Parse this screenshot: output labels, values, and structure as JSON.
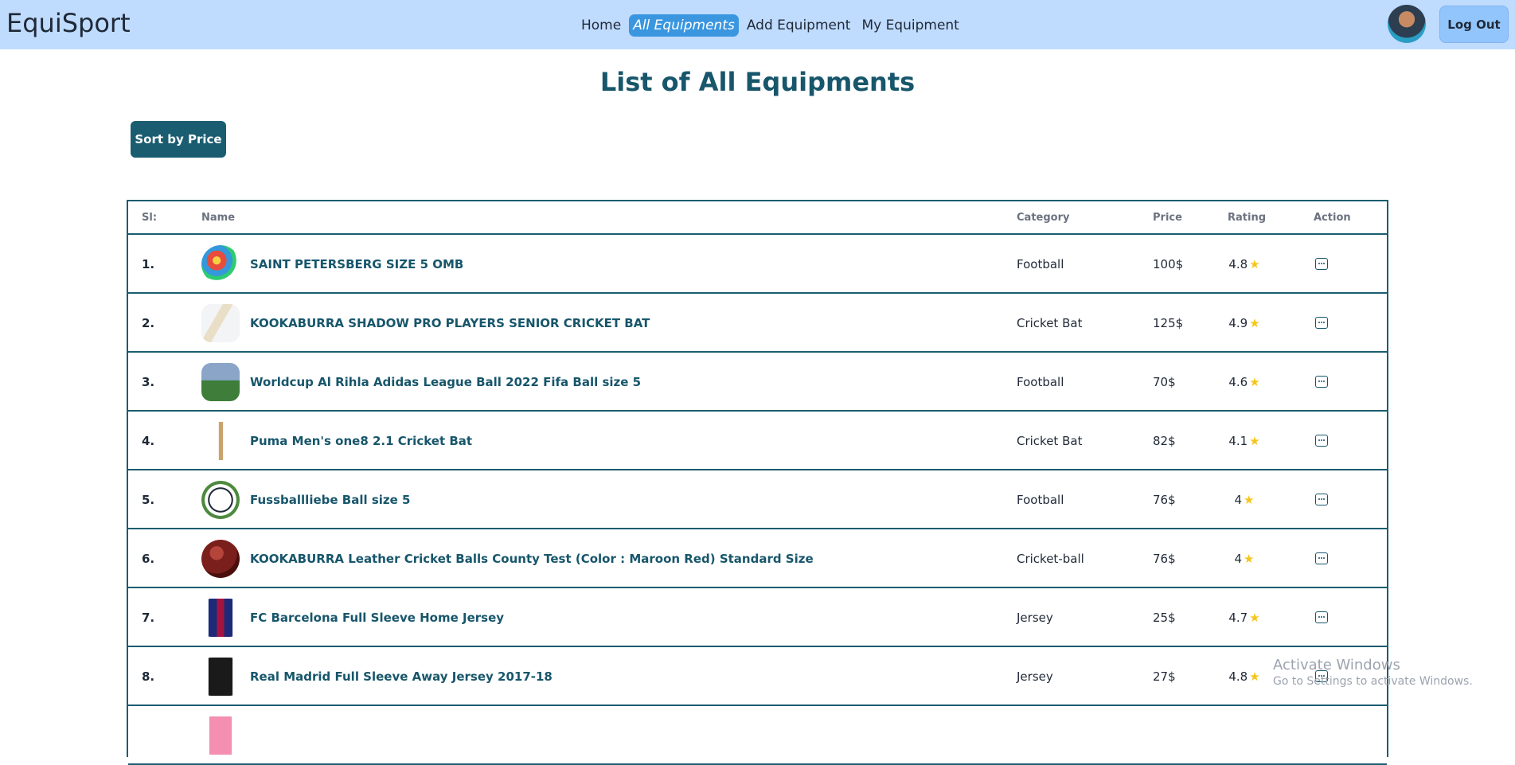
{
  "nav": {
    "brand": "EquiSport",
    "links": [
      "Home",
      "All Equipments",
      "Add Equipment",
      "My Equipment"
    ],
    "active": "All Equipments",
    "logout_label": "Log Out"
  },
  "page": {
    "title": "List of All Equipments",
    "sort_label": "Sort by Price"
  },
  "table": {
    "headers": [
      "Sl:",
      "Name",
      "Category",
      "Price",
      "Rating",
      "Action"
    ],
    "rows": [
      {
        "sl": "1.",
        "name": "SAINT PETERSBERG SIZE 5 OMB",
        "category": "Football",
        "price": "100$",
        "rating": "4.8",
        "thumb": "colorful-football"
      },
      {
        "sl": "2.",
        "name": "KOOKABURRA SHADOW PRO PLAYERS SENIOR CRICKET BAT",
        "category": "Cricket Bat",
        "price": "125$",
        "rating": "4.9",
        "thumb": "cricket-bat"
      },
      {
        "sl": "3.",
        "name": "Worldcup Al Rihla Adidas League Ball 2022 Fifa Ball size 5",
        "category": "Football",
        "price": "70$",
        "rating": "4.6",
        "thumb": "stadium-ball"
      },
      {
        "sl": "4.",
        "name": "Puma Men's one8 2.1 Cricket Bat",
        "category": "Cricket Bat",
        "price": "82$",
        "rating": "4.1",
        "thumb": "slim-bat"
      },
      {
        "sl": "5.",
        "name": "Fussballliebe Ball size 5",
        "category": "Football",
        "price": "76$",
        "rating": "4",
        "thumb": "white-football"
      },
      {
        "sl": "6.",
        "name": "KOOKABURRA Leather Cricket Balls County Test (Color : Maroon Red) Standard Size",
        "category": "Cricket-ball",
        "price": "76$",
        "rating": "4",
        "thumb": "cricket-ball"
      },
      {
        "sl": "7.",
        "name": "FC Barcelona Full Sleeve Home Jersey",
        "category": "Jersey",
        "price": "25$",
        "rating": "4.7",
        "thumb": "barca-jersey"
      },
      {
        "sl": "8.",
        "name": "Real Madrid Full Sleeve Away Jersey 2017-18",
        "category": "Jersey",
        "price": "27$",
        "rating": "4.8",
        "thumb": "madrid-jersey"
      },
      {
        "sl": "",
        "name": "",
        "category": "",
        "price": "",
        "rating": "",
        "thumb": "pink-jersey"
      }
    ]
  },
  "watermark": {
    "line1": "Activate Windows",
    "line2": "Go to Settings to activate Windows."
  }
}
